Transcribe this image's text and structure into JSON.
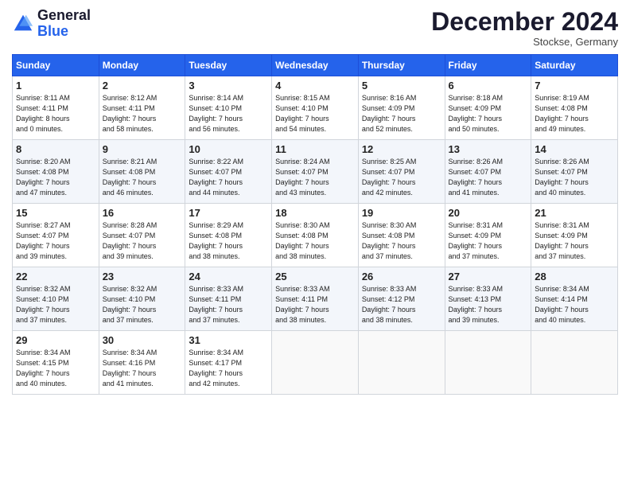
{
  "header": {
    "logo_line1": "General",
    "logo_line2": "Blue",
    "month": "December 2024",
    "location": "Stockse, Germany"
  },
  "days_of_week": [
    "Sunday",
    "Monday",
    "Tuesday",
    "Wednesday",
    "Thursday",
    "Friday",
    "Saturday"
  ],
  "weeks": [
    [
      {
        "day": "1",
        "lines": [
          "Sunrise: 8:11 AM",
          "Sunset: 4:11 PM",
          "Daylight: 8 hours",
          "and 0 minutes."
        ]
      },
      {
        "day": "2",
        "lines": [
          "Sunrise: 8:12 AM",
          "Sunset: 4:11 PM",
          "Daylight: 7 hours",
          "and 58 minutes."
        ]
      },
      {
        "day": "3",
        "lines": [
          "Sunrise: 8:14 AM",
          "Sunset: 4:10 PM",
          "Daylight: 7 hours",
          "and 56 minutes."
        ]
      },
      {
        "day": "4",
        "lines": [
          "Sunrise: 8:15 AM",
          "Sunset: 4:10 PM",
          "Daylight: 7 hours",
          "and 54 minutes."
        ]
      },
      {
        "day": "5",
        "lines": [
          "Sunrise: 8:16 AM",
          "Sunset: 4:09 PM",
          "Daylight: 7 hours",
          "and 52 minutes."
        ]
      },
      {
        "day": "6",
        "lines": [
          "Sunrise: 8:18 AM",
          "Sunset: 4:09 PM",
          "Daylight: 7 hours",
          "and 50 minutes."
        ]
      },
      {
        "day": "7",
        "lines": [
          "Sunrise: 8:19 AM",
          "Sunset: 4:08 PM",
          "Daylight: 7 hours",
          "and 49 minutes."
        ]
      }
    ],
    [
      {
        "day": "8",
        "lines": [
          "Sunrise: 8:20 AM",
          "Sunset: 4:08 PM",
          "Daylight: 7 hours",
          "and 47 minutes."
        ]
      },
      {
        "day": "9",
        "lines": [
          "Sunrise: 8:21 AM",
          "Sunset: 4:08 PM",
          "Daylight: 7 hours",
          "and 46 minutes."
        ]
      },
      {
        "day": "10",
        "lines": [
          "Sunrise: 8:22 AM",
          "Sunset: 4:07 PM",
          "Daylight: 7 hours",
          "and 44 minutes."
        ]
      },
      {
        "day": "11",
        "lines": [
          "Sunrise: 8:24 AM",
          "Sunset: 4:07 PM",
          "Daylight: 7 hours",
          "and 43 minutes."
        ]
      },
      {
        "day": "12",
        "lines": [
          "Sunrise: 8:25 AM",
          "Sunset: 4:07 PM",
          "Daylight: 7 hours",
          "and 42 minutes."
        ]
      },
      {
        "day": "13",
        "lines": [
          "Sunrise: 8:26 AM",
          "Sunset: 4:07 PM",
          "Daylight: 7 hours",
          "and 41 minutes."
        ]
      },
      {
        "day": "14",
        "lines": [
          "Sunrise: 8:26 AM",
          "Sunset: 4:07 PM",
          "Daylight: 7 hours",
          "and 40 minutes."
        ]
      }
    ],
    [
      {
        "day": "15",
        "lines": [
          "Sunrise: 8:27 AM",
          "Sunset: 4:07 PM",
          "Daylight: 7 hours",
          "and 39 minutes."
        ]
      },
      {
        "day": "16",
        "lines": [
          "Sunrise: 8:28 AM",
          "Sunset: 4:07 PM",
          "Daylight: 7 hours",
          "and 39 minutes."
        ]
      },
      {
        "day": "17",
        "lines": [
          "Sunrise: 8:29 AM",
          "Sunset: 4:08 PM",
          "Daylight: 7 hours",
          "and 38 minutes."
        ]
      },
      {
        "day": "18",
        "lines": [
          "Sunrise: 8:30 AM",
          "Sunset: 4:08 PM",
          "Daylight: 7 hours",
          "and 38 minutes."
        ]
      },
      {
        "day": "19",
        "lines": [
          "Sunrise: 8:30 AM",
          "Sunset: 4:08 PM",
          "Daylight: 7 hours",
          "and 37 minutes."
        ]
      },
      {
        "day": "20",
        "lines": [
          "Sunrise: 8:31 AM",
          "Sunset: 4:09 PM",
          "Daylight: 7 hours",
          "and 37 minutes."
        ]
      },
      {
        "day": "21",
        "lines": [
          "Sunrise: 8:31 AM",
          "Sunset: 4:09 PM",
          "Daylight: 7 hours",
          "and 37 minutes."
        ]
      }
    ],
    [
      {
        "day": "22",
        "lines": [
          "Sunrise: 8:32 AM",
          "Sunset: 4:10 PM",
          "Daylight: 7 hours",
          "and 37 minutes."
        ]
      },
      {
        "day": "23",
        "lines": [
          "Sunrise: 8:32 AM",
          "Sunset: 4:10 PM",
          "Daylight: 7 hours",
          "and 37 minutes."
        ]
      },
      {
        "day": "24",
        "lines": [
          "Sunrise: 8:33 AM",
          "Sunset: 4:11 PM",
          "Daylight: 7 hours",
          "and 37 minutes."
        ]
      },
      {
        "day": "25",
        "lines": [
          "Sunrise: 8:33 AM",
          "Sunset: 4:11 PM",
          "Daylight: 7 hours",
          "and 38 minutes."
        ]
      },
      {
        "day": "26",
        "lines": [
          "Sunrise: 8:33 AM",
          "Sunset: 4:12 PM",
          "Daylight: 7 hours",
          "and 38 minutes."
        ]
      },
      {
        "day": "27",
        "lines": [
          "Sunrise: 8:33 AM",
          "Sunset: 4:13 PM",
          "Daylight: 7 hours",
          "and 39 minutes."
        ]
      },
      {
        "day": "28",
        "lines": [
          "Sunrise: 8:34 AM",
          "Sunset: 4:14 PM",
          "Daylight: 7 hours",
          "and 40 minutes."
        ]
      }
    ],
    [
      {
        "day": "29",
        "lines": [
          "Sunrise: 8:34 AM",
          "Sunset: 4:15 PM",
          "Daylight: 7 hours",
          "and 40 minutes."
        ]
      },
      {
        "day": "30",
        "lines": [
          "Sunrise: 8:34 AM",
          "Sunset: 4:16 PM",
          "Daylight: 7 hours",
          "and 41 minutes."
        ]
      },
      {
        "day": "31",
        "lines": [
          "Sunrise: 8:34 AM",
          "Sunset: 4:17 PM",
          "Daylight: 7 hours",
          "and 42 minutes."
        ]
      },
      null,
      null,
      null,
      null
    ]
  ]
}
